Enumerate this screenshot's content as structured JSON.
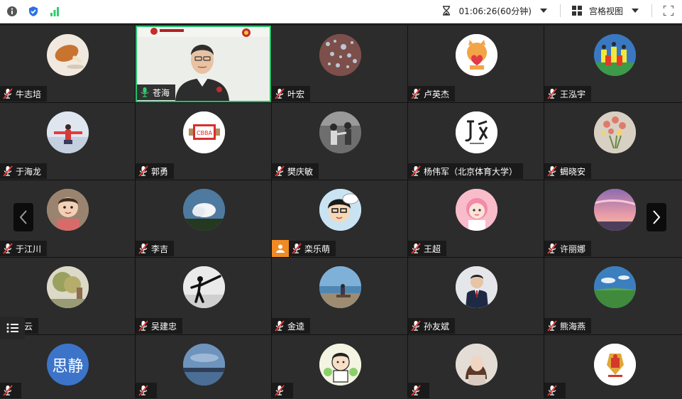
{
  "toolbar": {
    "timer": "01:06:26(60分钟)",
    "view_label": "宫格视图",
    "colors": {
      "info": "#555555",
      "shield": "#2f6fe4",
      "signal": "#2ecc71"
    }
  },
  "participants": [
    {
      "name": "牛志培",
      "avatar": "drumstick",
      "bg": "#f1e9df"
    },
    {
      "name": "苍海",
      "avatar": "video",
      "active": true
    },
    {
      "name": "叶宏",
      "avatar": "scatter",
      "bg": "#8a5f5a"
    },
    {
      "name": "卢英杰",
      "avatar": "cartoon-cat",
      "bg": "#ffffff"
    },
    {
      "name": "王泓宇",
      "avatar": "team-photo",
      "bg": "#3f6ba5"
    },
    {
      "name": "于海龙",
      "avatar": "snow-person",
      "bg": "#cfd9e8"
    },
    {
      "name": "郭勇",
      "avatar": "cbba-logo",
      "bg": "#ffffff"
    },
    {
      "name": "樊庆敏",
      "avatar": "bw-martial",
      "bg": "#777777"
    },
    {
      "name": "杨伟军（北京体育大学）",
      "avatar": "fencing-logo",
      "bg": "#ffffff"
    },
    {
      "name": "蝎晓安",
      "avatar": "flowers",
      "bg": "#cfc6b8"
    },
    {
      "name": "于江川",
      "avatar": "child-photo",
      "bg": "#b09a84"
    },
    {
      "name": "李吉",
      "avatar": "cloud-sky",
      "bg": "#5d86a8"
    },
    {
      "name": "栾乐萌",
      "avatar": "cartoon-face",
      "bg": "#c9e3f2",
      "host": true
    },
    {
      "name": "王超",
      "avatar": "pink-girl",
      "bg": "#f6b5c3"
    },
    {
      "name": "许丽娜",
      "avatar": "sunset",
      "bg": "#c79ab8"
    },
    {
      "name": "薛云",
      "avatar": "tree-photo",
      "bg": "#c7c1a3"
    },
    {
      "name": "吴建忠",
      "avatar": "kick-silhouette",
      "bg": "#e7e7e7"
    },
    {
      "name": "金逵",
      "avatar": "lake-person",
      "bg": "#6f9fc8"
    },
    {
      "name": "孙友斌",
      "avatar": "suit-man",
      "bg": "#dfe2e6"
    },
    {
      "name": "熊海燕",
      "avatar": "grassland",
      "bg": "#4d88b8"
    },
    {
      "name": "",
      "avatar": "text",
      "text": "思静",
      "bg": "#3c74c9"
    },
    {
      "name": "",
      "avatar": "lake-dusk",
      "bg": "#557ba1"
    },
    {
      "name": "",
      "avatar": "cartoon-kids",
      "bg": "#eef0d8"
    },
    {
      "name": "",
      "avatar": "woman-portrait",
      "bg": "#ded6cf"
    },
    {
      "name": "",
      "avatar": "red-emblem",
      "bg": "#ffffff"
    }
  ]
}
